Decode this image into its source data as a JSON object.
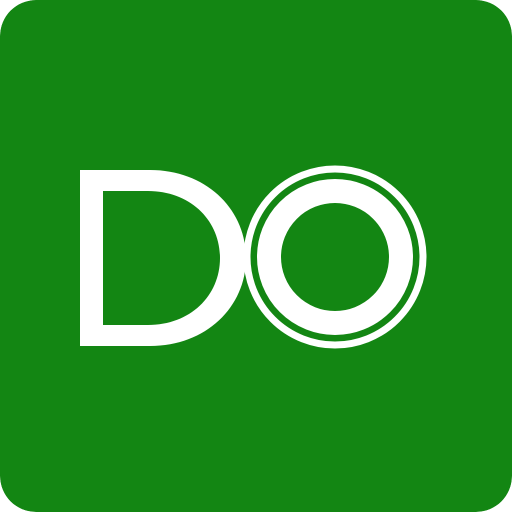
{
  "logo": {
    "text": "DO",
    "icon": "do-monogram-logo",
    "colors": {
      "background": "#138613",
      "foreground": "#ffffff"
    }
  }
}
